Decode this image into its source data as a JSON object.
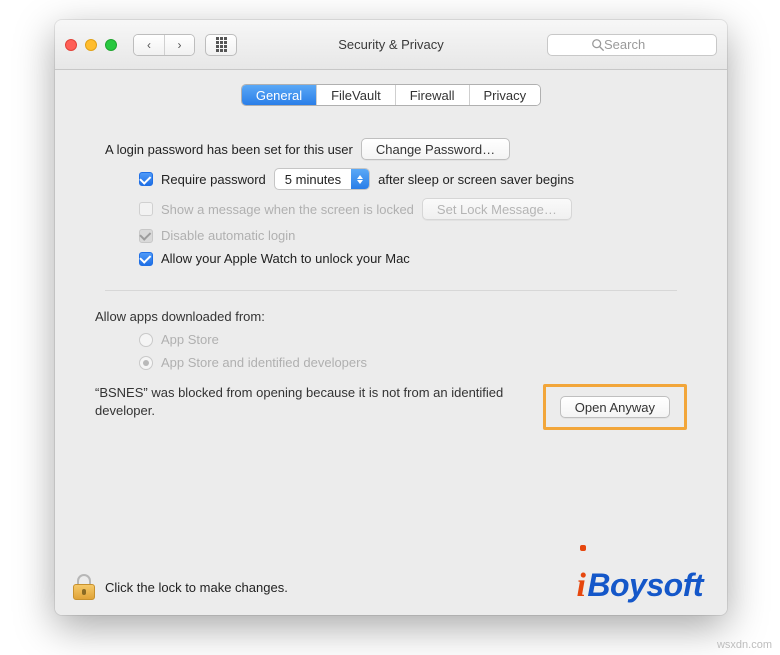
{
  "toolbar": {
    "title": "Security & Privacy",
    "search_placeholder": "Search"
  },
  "tabs": {
    "general": "General",
    "filevault": "FileVault",
    "firewall": "Firewall",
    "privacy": "Privacy"
  },
  "general": {
    "login_password_set": "A login password has been set for this user",
    "change_password": "Change Password…",
    "require_password": "Require password",
    "require_password_delay": "5 minutes",
    "require_password_suffix": "after sleep or screen saver begins",
    "show_message": "Show a message when the screen is locked",
    "set_lock_message": "Set Lock Message…",
    "disable_auto_login": "Disable automatic login",
    "apple_watch_unlock": "Allow your Apple Watch to unlock your Mac"
  },
  "downloads": {
    "section_title": "Allow apps downloaded from:",
    "app_store": "App Store",
    "app_store_identified": "App Store and identified developers",
    "blocked_message": "“BSNES” was blocked from opening because it is not from an identified developer.",
    "open_anyway": "Open Anyway"
  },
  "lockbar": {
    "message": "Click the lock to make changes."
  },
  "brand": {
    "i": "i",
    "rest": "Boysoft"
  },
  "watermark": "wsxdn.com"
}
